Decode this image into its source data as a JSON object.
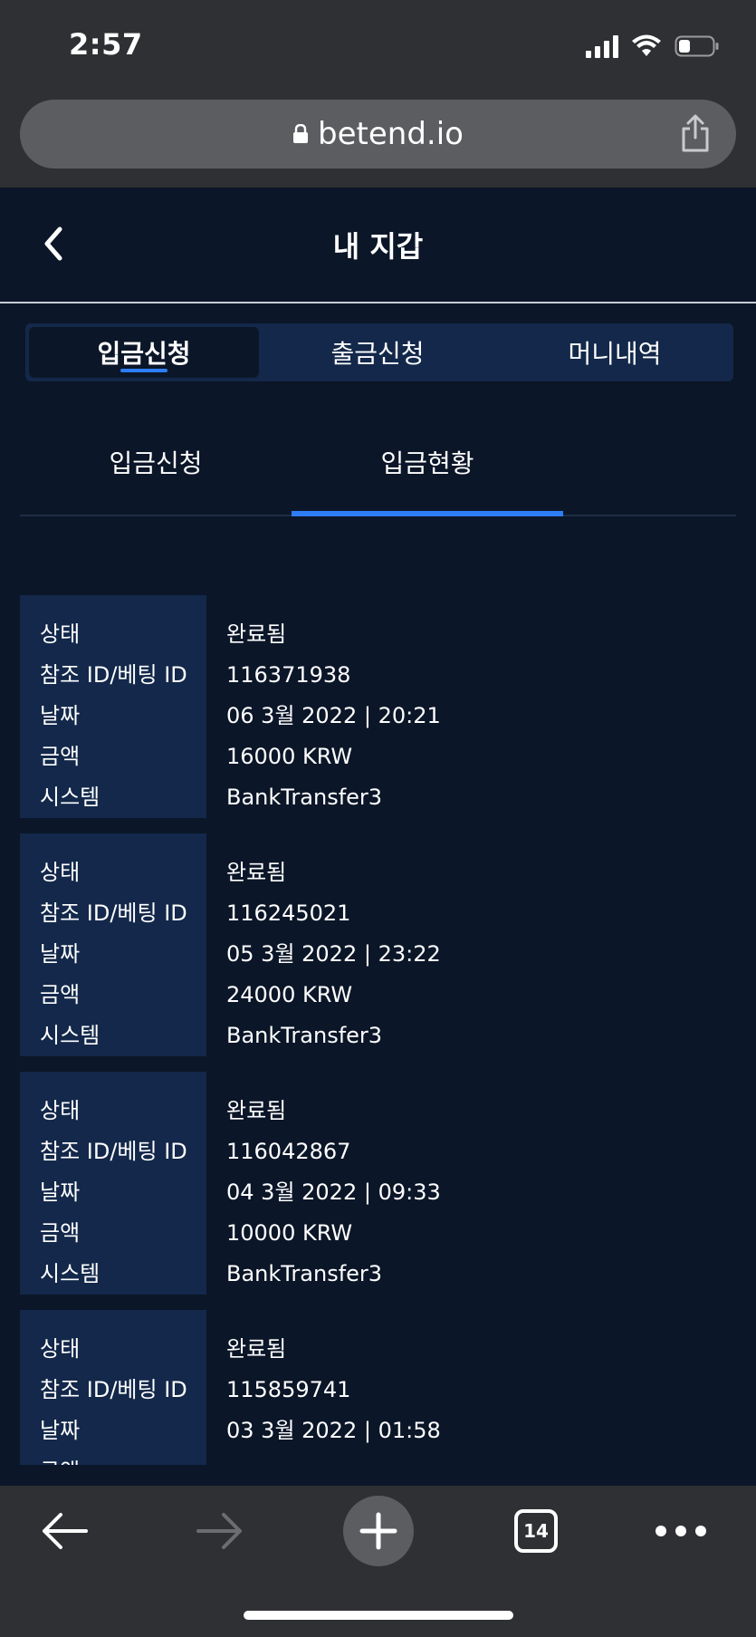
{
  "status_bar": {
    "time": "2:57"
  },
  "browser": {
    "url": "betend.io",
    "tab_count": "14"
  },
  "header": {
    "title": "내 지갑"
  },
  "main_tabs": [
    {
      "label": "입금신청",
      "active": true
    },
    {
      "label": "출금신청",
      "active": false
    },
    {
      "label": "머니내역",
      "active": false
    }
  ],
  "sub_tabs": [
    {
      "label": "입금신청",
      "active": false
    },
    {
      "label": "입금현황",
      "active": true
    }
  ],
  "field_labels": {
    "status": "상태",
    "ref_id": "참조 ID/베팅 ID",
    "date": "날짜",
    "amount": "금액",
    "system": "시스템"
  },
  "deposits": [
    {
      "status": "완료됨",
      "ref_id": "116371938",
      "date": "06 3월 2022 | 20:21",
      "amount": "16000 KRW",
      "system": "BankTransfer3"
    },
    {
      "status": "완료됨",
      "ref_id": "116245021",
      "date": "05 3월 2022 | 23:22",
      "amount": "24000 KRW",
      "system": "BankTransfer3"
    },
    {
      "status": "완료됨",
      "ref_id": "116042867",
      "date": "04 3월 2022 | 09:33",
      "amount": "10000 KRW",
      "system": "BankTransfer3"
    },
    {
      "status": "완료됨",
      "ref_id": "115859741",
      "date": "03 3월 2022 | 01:58",
      "amount": "",
      "system": ""
    }
  ],
  "colors": {
    "accent": "#2f7df6",
    "background": "#0b1628",
    "panel": "#13284a"
  }
}
